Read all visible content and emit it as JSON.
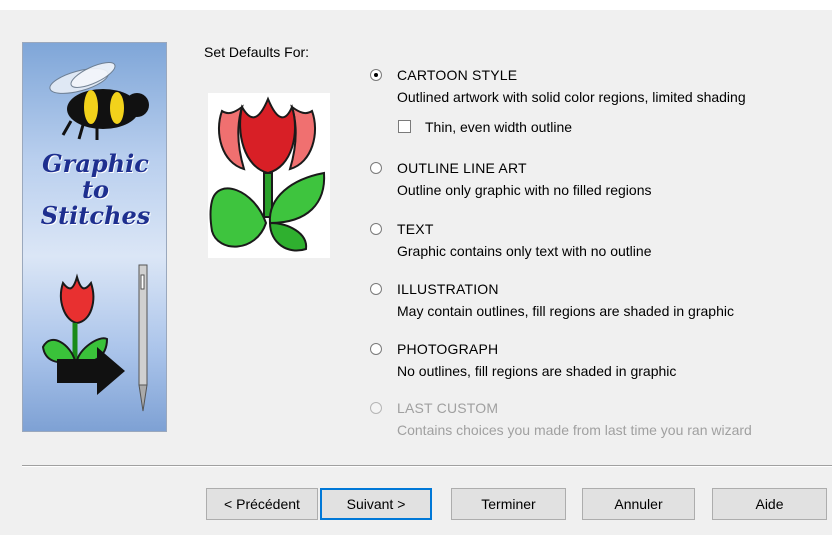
{
  "banner": {
    "title_lines": [
      "Graphic",
      "to",
      "Stitches"
    ]
  },
  "defaults": {
    "label": "Set Defaults For:",
    "options": [
      {
        "title": "CARTOON STYLE",
        "description": "Outlined artwork with solid color regions, limited shading",
        "selected": true,
        "enabled": true
      },
      {
        "title": "OUTLINE LINE ART",
        "description": "Outline only graphic with no filled regions",
        "selected": false,
        "enabled": true
      },
      {
        "title": "TEXT",
        "description": "Graphic contains only text with no outline",
        "selected": false,
        "enabled": true
      },
      {
        "title": "ILLUSTRATION",
        "description": "May contain outlines, fill regions are shaded in graphic",
        "selected": false,
        "enabled": true
      },
      {
        "title": "PHOTOGRAPH",
        "description": "No outlines, fill regions are shaded in graphic",
        "selected": false,
        "enabled": true
      },
      {
        "title": "LAST CUSTOM",
        "description": "Contains choices you made from last time you ran wizard",
        "selected": false,
        "enabled": false
      }
    ],
    "thin_outline": {
      "label": "Thin, even width outline",
      "checked": false
    }
  },
  "buttons": {
    "previous": "< Précédent",
    "next": "Suivant >",
    "finish": "Terminer",
    "cancel": "Annuler",
    "help": "Aide"
  }
}
